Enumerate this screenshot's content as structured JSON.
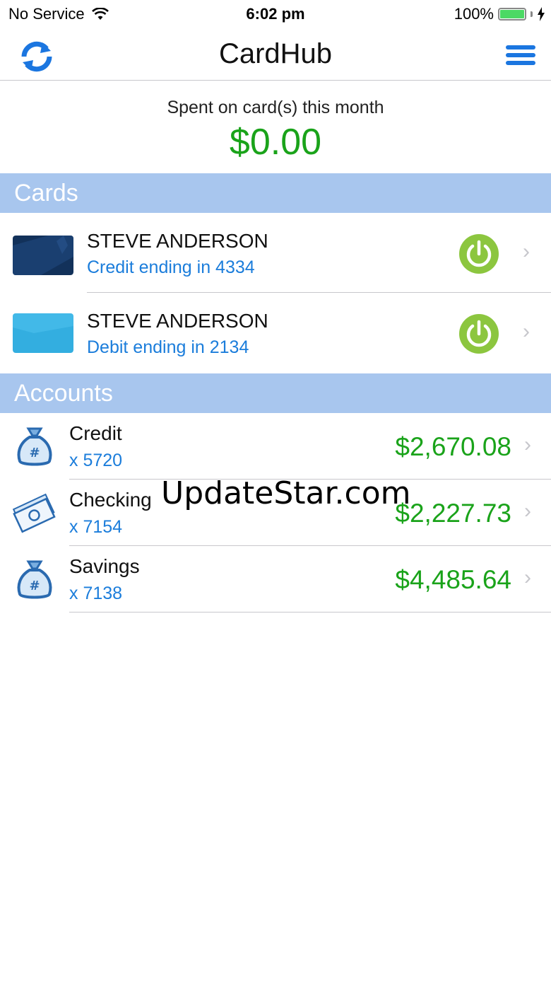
{
  "status_bar": {
    "carrier": "No Service",
    "time": "6:02 pm",
    "battery": "100%",
    "battery_level": 1.0
  },
  "nav": {
    "title": "CardHub",
    "left_icon": "refresh-icon",
    "right_icon": "hamburger-menu-icon"
  },
  "summary": {
    "label": "Spent on card(s) this month",
    "amount": "$0.00"
  },
  "cards_section": {
    "title": "Cards",
    "items": [
      {
        "name": "STEVE ANDERSON",
        "subtitle": "Credit ending in 4334",
        "card_color": "#12315a",
        "toggle_state": "on"
      },
      {
        "name": "STEVE ANDERSON",
        "subtitle": "Debit ending in 2134",
        "card_color": "#33aee0",
        "toggle_state": "on"
      }
    ]
  },
  "accounts_section": {
    "title": "Accounts",
    "items": [
      {
        "name": "Credit",
        "number": "x 5720",
        "balance": "$2,670.08",
        "icon": "money-bag-icon"
      },
      {
        "name": "Checking",
        "number": "x 7154",
        "balance": "$2,227.73",
        "icon": "cash-stack-icon"
      },
      {
        "name": "Savings",
        "number": "x 7138",
        "balance": "$4,485.64",
        "icon": "money-bag-icon"
      }
    ]
  },
  "watermark": "UpdateStar.com",
  "colors": {
    "accent_blue": "#1b76e0",
    "section_header": "#a8c6ee",
    "positive_green": "#1aa31a",
    "power_green": "#8cc63f"
  }
}
